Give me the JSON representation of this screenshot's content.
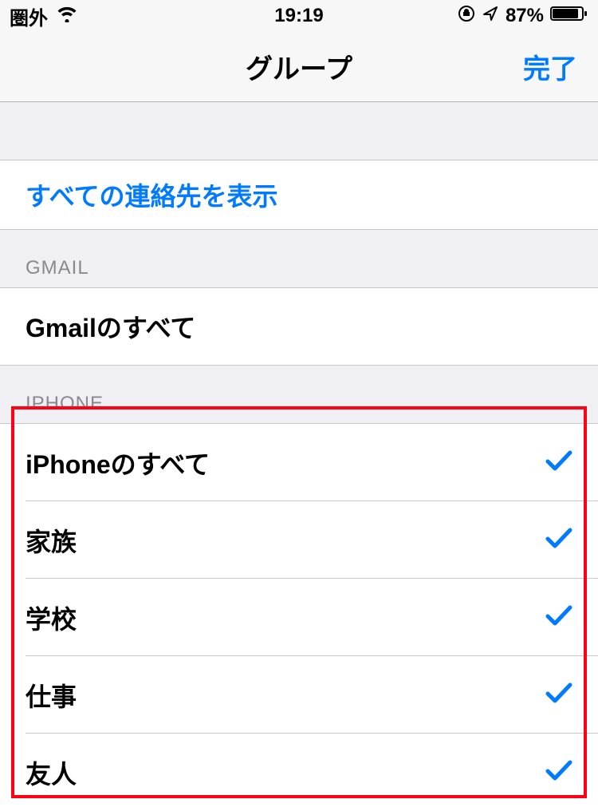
{
  "status": {
    "carrier": "圏外",
    "time": "19:19",
    "battery": "87%"
  },
  "nav": {
    "title": "グループ",
    "done": "完了"
  },
  "actions": {
    "show_all": "すべての連絡先を表示"
  },
  "sections": {
    "gmail": {
      "header": "GMAIL",
      "items": [
        {
          "label": "Gmailのすべて",
          "checked": false
        }
      ]
    },
    "iphone": {
      "header": "IPHONE",
      "items": [
        {
          "label": "iPhoneのすべて",
          "checked": true
        },
        {
          "label": "家族",
          "checked": true
        },
        {
          "label": "学校",
          "checked": true
        },
        {
          "label": "仕事",
          "checked": true
        },
        {
          "label": "友人",
          "checked": true
        }
      ]
    }
  }
}
